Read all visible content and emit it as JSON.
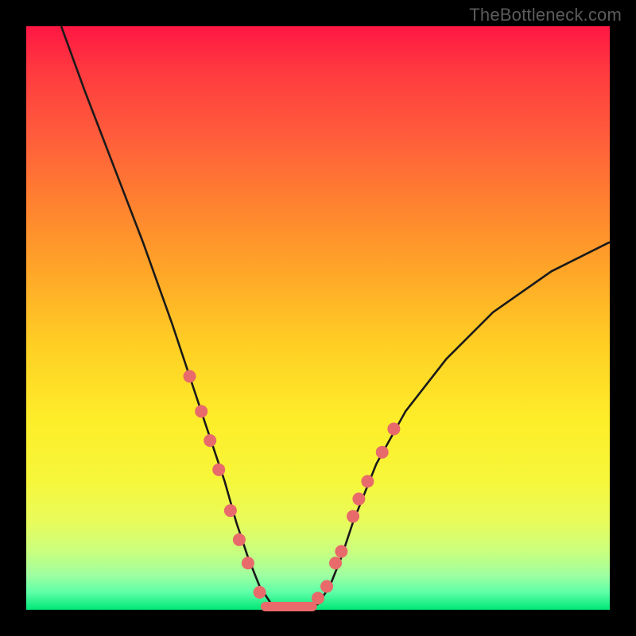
{
  "watermark": "TheBottleneck.com",
  "chart_data": {
    "type": "line",
    "title": "",
    "xlabel": "",
    "ylabel": "",
    "xlim": [
      0,
      100
    ],
    "ylim": [
      0,
      100
    ],
    "background_gradient": {
      "top": "#ff1744",
      "mid": "#ffd024",
      "bottom": "#00e676"
    },
    "series": [
      {
        "name": "bottleneck-curve",
        "x": [
          6,
          10,
          15,
          20,
          25,
          28,
          31,
          34,
          36,
          38,
          40,
          42,
          44,
          46,
          48,
          50,
          52,
          54,
          56,
          60,
          65,
          72,
          80,
          90,
          100
        ],
        "y": [
          100,
          89,
          76,
          63,
          49,
          40,
          31,
          22,
          15,
          9,
          4,
          1,
          0,
          0,
          0,
          1,
          4,
          9,
          15,
          25,
          34,
          43,
          51,
          58,
          63
        ]
      }
    ],
    "markers": {
      "name": "highlighted-points",
      "color": "#e86a6a",
      "radius": 8,
      "points": [
        {
          "x": 28,
          "y": 40
        },
        {
          "x": 30,
          "y": 34
        },
        {
          "x": 31.5,
          "y": 29
        },
        {
          "x": 33,
          "y": 24
        },
        {
          "x": 35,
          "y": 17
        },
        {
          "x": 36.5,
          "y": 12
        },
        {
          "x": 38,
          "y": 8
        },
        {
          "x": 40,
          "y": 3
        },
        {
          "x": 50,
          "y": 2
        },
        {
          "x": 51.5,
          "y": 4
        },
        {
          "x": 53,
          "y": 8
        },
        {
          "x": 54,
          "y": 10
        },
        {
          "x": 56,
          "y": 16
        },
        {
          "x": 57,
          "y": 19
        },
        {
          "x": 58.5,
          "y": 22
        },
        {
          "x": 61,
          "y": 27
        },
        {
          "x": 63,
          "y": 31
        }
      ]
    },
    "flat_segment": {
      "name": "valley-floor",
      "color": "#e86a6a",
      "x_start": 41,
      "x_end": 49,
      "y": 0
    }
  }
}
